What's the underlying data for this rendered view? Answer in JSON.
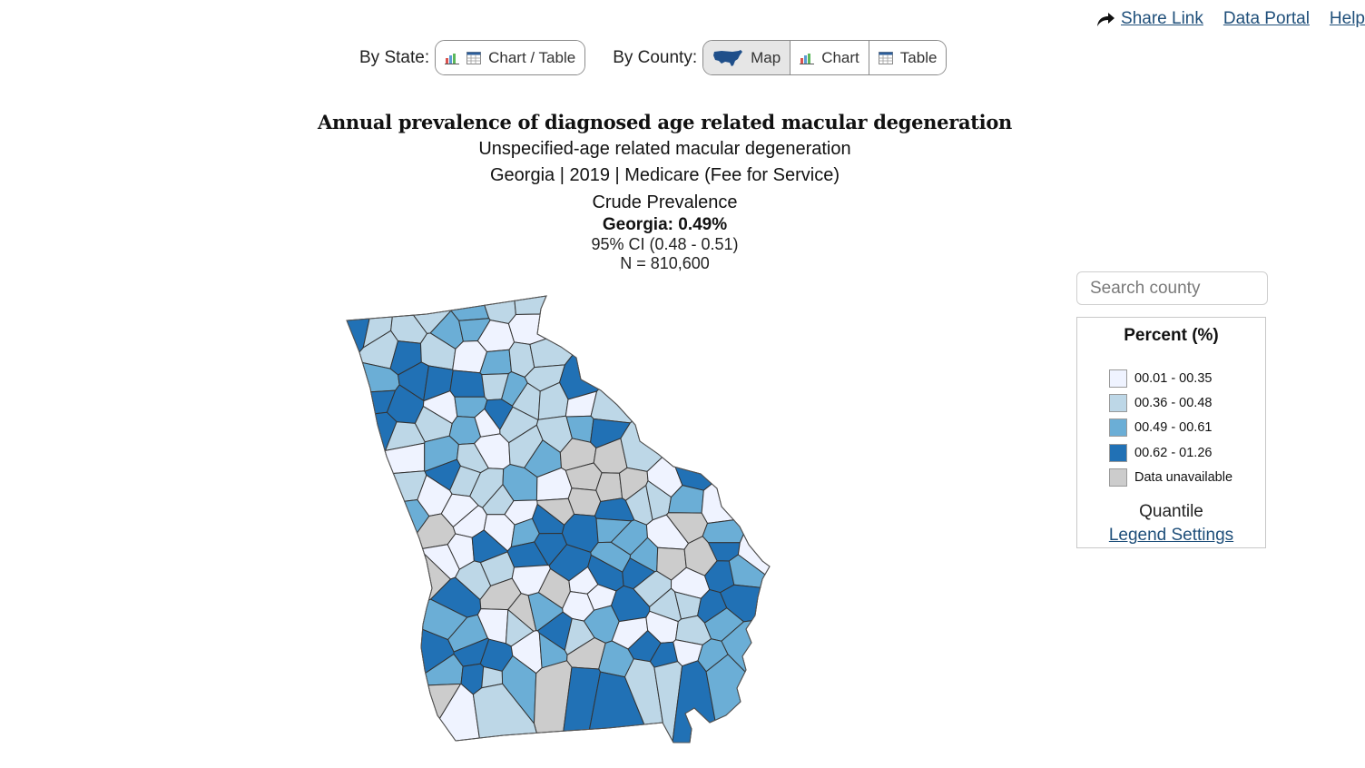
{
  "header": {
    "links": [
      {
        "label": " Share Link",
        "icon": "share-icon"
      },
      {
        "label": "Data Portal"
      },
      {
        "label": "Help"
      }
    ]
  },
  "view_controls": {
    "by_state_label": "By State:",
    "by_state_buttons": [
      {
        "label": "Chart / Table",
        "icons": [
          "bar-chart-icon",
          "table-icon"
        ]
      }
    ],
    "by_county_label": "By County:",
    "by_county_buttons": [
      {
        "label": "Map",
        "icon": "us-map-icon",
        "active": true
      },
      {
        "label": "Chart",
        "icon": "bar-chart-icon",
        "active": false
      },
      {
        "label": "Table",
        "icon": "table-icon",
        "active": false
      }
    ]
  },
  "titles": {
    "title": "Annual prevalence of diagnosed age related macular degeneration",
    "subtitle": "Unspecified-age related macular degeneration",
    "meta": "Georgia | 2019 | Medicare (Fee for Service)",
    "measure": "Crude Prevalence",
    "state_value": "Georgia: 0.49%",
    "ci": "95% CI (0.48 - 0.51)",
    "n": "N = 810,600"
  },
  "search": {
    "placeholder": "Search county",
    "value": ""
  },
  "legend": {
    "title": "Percent (%)",
    "classification": "Quantile",
    "settings_link": "Legend Settings",
    "classes": [
      {
        "label": "00.01 - 00.35",
        "color": "#eff3ff"
      },
      {
        "label": "00.36 - 00.48",
        "color": "#bdd7e7"
      },
      {
        "label": "00.49 - 00.61",
        "color": "#6baed6"
      },
      {
        "label": "00.62 - 01.26",
        "color": "#2171b5"
      },
      {
        "label": "Data unavailable",
        "color": "#cccccc"
      }
    ]
  },
  "map": {
    "state": "Georgia",
    "county_count": 159,
    "class_legend_index": "0=lightest, 1=light, 2=medium, 3=dark, 4=unavailable",
    "county_classes": [
      1,
      2,
      1,
      1,
      3,
      1,
      1,
      2,
      2,
      0,
      0,
      1,
      3,
      1,
      0,
      2,
      1,
      1,
      2,
      3,
      3,
      3,
      1,
      2,
      1,
      3,
      3,
      3,
      0,
      2,
      3,
      1,
      1,
      0,
      1,
      3,
      1,
      1,
      2,
      0,
      1,
      1,
      2,
      3,
      0,
      2,
      1,
      0,
      1,
      2,
      4,
      4,
      1,
      1,
      3,
      1,
      1,
      2,
      0,
      4,
      4,
      4,
      0,
      3,
      2,
      0,
      0,
      1,
      0,
      4,
      4,
      3,
      1,
      1,
      2,
      0,
      4,
      0,
      0,
      2,
      3,
      3,
      2,
      2,
      0,
      4,
      2,
      0,
      0,
      3,
      3,
      3,
      3,
      2,
      2,
      4,
      4,
      3,
      0,
      4,
      1,
      1,
      0,
      4,
      0,
      3,
      3,
      1,
      0,
      3,
      2,
      3,
      4,
      4,
      2,
      0,
      0,
      3,
      1,
      1,
      3,
      3,
      2,
      2,
      0,
      1,
      3,
      1,
      2,
      0,
      0,
      1,
      2,
      3,
      3,
      3,
      0,
      2,
      4,
      2,
      3,
      3,
      0,
      2,
      2,
      2,
      3,
      1,
      2,
      4,
      3,
      3,
      1,
      1,
      3,
      2,
      4,
      0,
      1
    ]
  }
}
